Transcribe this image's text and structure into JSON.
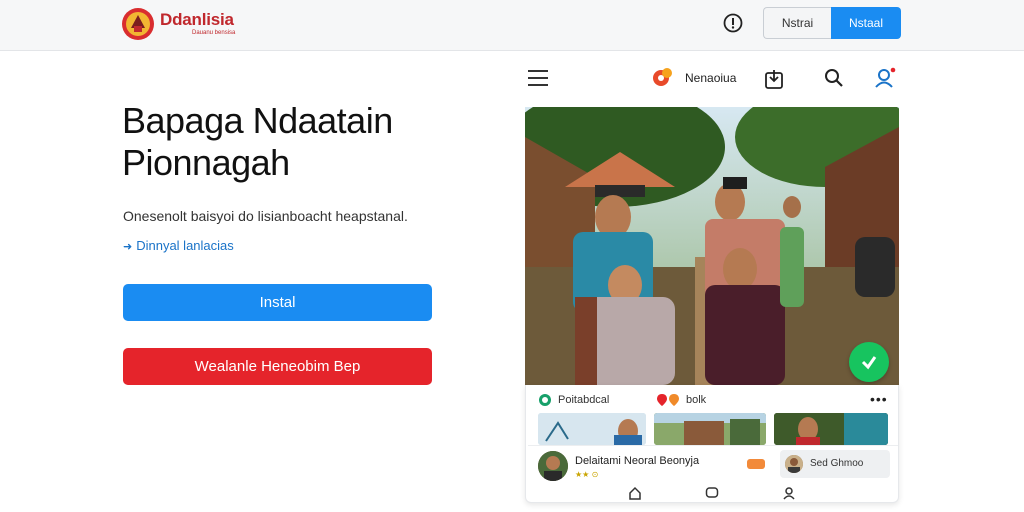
{
  "header": {
    "brand_title": "Ddanlisia",
    "brand_subtitle": "Dauanu bensisa",
    "btn_secondary": "Nstrai",
    "btn_primary": "Nstaal"
  },
  "hero": {
    "title_line1": "Bapaga Ndaatain",
    "title_line2": "Pionnagah",
    "subtitle": "Onesenolt baisyoi do lisianboacht heapstanal.",
    "link": "Dinnyal lanlacias",
    "install_button": "Instal",
    "secondary_button": "Wealanle Heneobim Bep"
  },
  "phone": {
    "app_name": "Nenaoiua",
    "feed_tag1": "Poitabdcal",
    "feed_tag2": "bolk",
    "more": "•••",
    "card_name": "Delaitami Neoral Beonyja",
    "card_meta": "★★ ⊙",
    "chat_label": "Sed Ghmoo"
  },
  "colors": {
    "accent_blue": "#1a8cf2",
    "accent_red": "#e5242b",
    "fab_green": "#17c45f"
  },
  "icons": {
    "info": "info-icon",
    "menu": "hamburger-icon",
    "share": "share-icon",
    "search": "search-icon",
    "user": "user-icon",
    "check": "check-icon",
    "home": "home-icon",
    "chat": "chat-icon",
    "profile": "profile-icon"
  }
}
